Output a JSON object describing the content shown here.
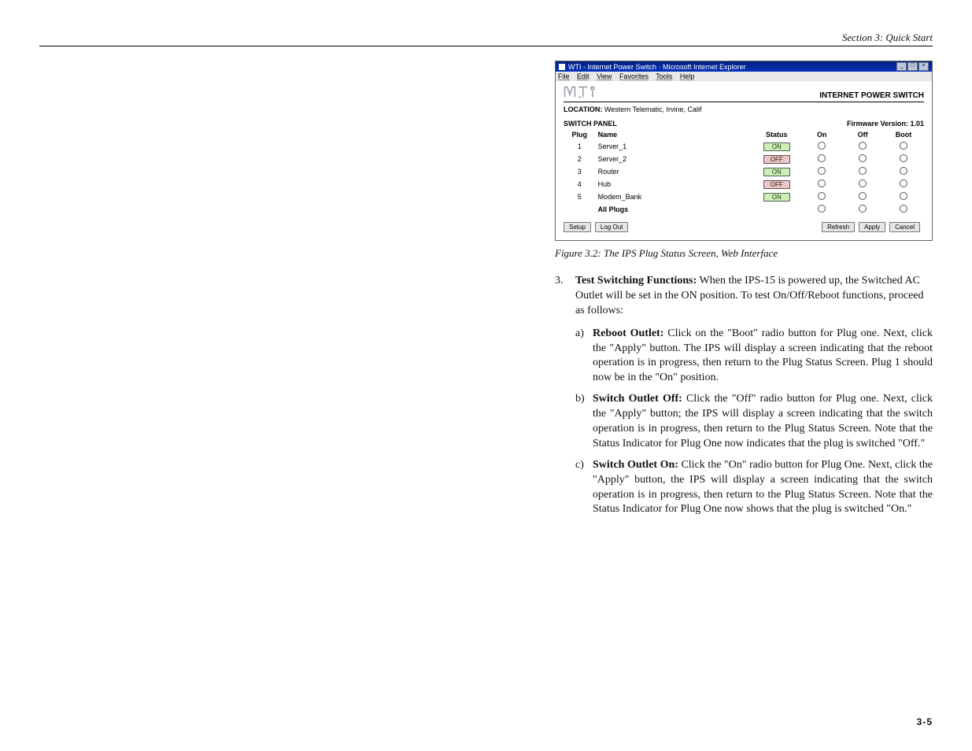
{
  "header": {
    "section": "Section 3:  Quick Start"
  },
  "browser": {
    "title": "WTI - Internet Power Switch · Microsoft Internet Explorer",
    "menus": [
      "File",
      "Edit",
      "View",
      "Favorites",
      "Tools",
      "Help"
    ],
    "product_name": "INTERNET POWER SWITCH",
    "location_label": "LOCATION:",
    "location_value": "Western Telematic, Irvine, Calif",
    "panel_title": "SWITCH PANEL",
    "firmware": "Firmware Version: 1.01",
    "cols": {
      "plug": "Plug",
      "name": "Name",
      "status": "Status",
      "on": "On",
      "off": "Off",
      "boot": "Boot"
    },
    "rows": [
      {
        "plug": "1",
        "name": "Server_1",
        "status": "ON"
      },
      {
        "plug": "2",
        "name": "Server_2",
        "status": "OFF"
      },
      {
        "plug": "3",
        "name": "Router",
        "status": "ON"
      },
      {
        "plug": "4",
        "name": "Hub",
        "status": "OFF"
      },
      {
        "plug": "5",
        "name": "Modem_Bank",
        "status": "ON"
      }
    ],
    "all_plugs": "All Plugs",
    "buttons": {
      "setup": "Setup",
      "logout": "Log Out",
      "refresh": "Refresh",
      "apply": "Apply",
      "cancel": "Cancel"
    }
  },
  "figure_caption": "Figure 3.2: The IPS Plug Status Screen, Web Interface",
  "step": {
    "num": "3.",
    "title": "Test Switching Functions:",
    "text": "  When the IPS-15 is powered up, the Switched AC Outlet will be set in the ON position.  To test On/Off/Reboot functions, proceed as follows:"
  },
  "subs": [
    {
      "lbl": "a)",
      "title": "Reboot Outlet:",
      "text": "  Click on the \"Boot\" radio button for Plug one.  Next, click the \"Apply\" button.  The IPS will display a screen indicating that the reboot operation is in progress, then return to the Plug Status Screen.  Plug 1 should now be in the \"On\" position."
    },
    {
      "lbl": "b)",
      "title": "Switch Outlet Off:",
      "text": "  Click the \"Off\" radio button for Plug one.  Next, click the \"Apply\" button; the IPS will display a screen indicating that the switch operation is in progress, then return to the Plug Status Screen.  Note that the Status Indicator for Plug One now indicates that the plug is switched \"Off.\""
    },
    {
      "lbl": "c)",
      "title": "Switch Outlet On:",
      "text": "  Click the \"On\" radio button for Plug One.  Next, click the \"Apply\" button, the IPS will display a screen indicating that the switch operation is in progress, then return to the Plug Status Screen.  Note that the Status Indicator for Plug One now shows that the plug is switched \"On.\""
    }
  ],
  "page_number": "3-5"
}
